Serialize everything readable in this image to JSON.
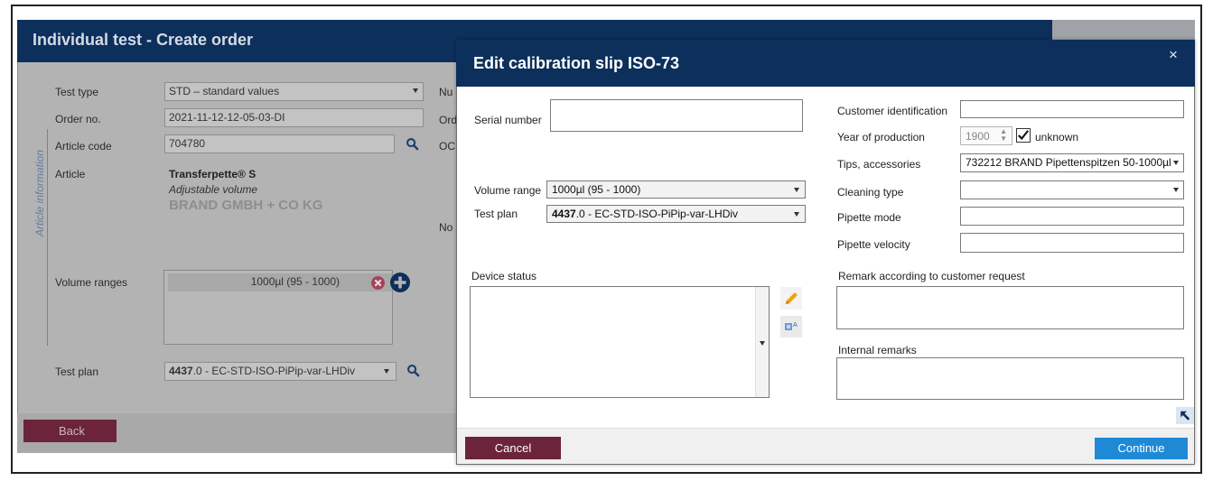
{
  "background_window": {
    "title": "Individual test - Create order",
    "side_label": "Article information",
    "fields": {
      "test_type_label": "Test type",
      "test_type_value": "STD – standard values",
      "order_no_label": "Order no.",
      "order_no_value": "2021-11-12-12-05-03-DI",
      "article_code_label": "Article code",
      "article_code_value": "704780",
      "article_label": "Article",
      "article_name": "Transferpette® S",
      "article_sub": "Adjustable volume",
      "article_maker": "BRAND GMBH + CO KG",
      "volume_ranges_label": "Volume ranges",
      "volume_range_chip": "1000µl (95 - 1000)",
      "test_plan_label": "Test plan",
      "test_plan_bold": "4437",
      "test_plan_rest": ".0 - EC-STD-ISO-PiPip-var-LHDiv"
    },
    "right_labels": [
      "Nu",
      "Ord",
      "OC",
      "No"
    ],
    "back_label": "Back"
  },
  "modal": {
    "title": "Edit calibration slip ISO-73",
    "close_glyph": "×",
    "serial_number_label": "Serial number",
    "serial_number_value": "",
    "volume_range_label": "Volume range",
    "volume_range_value": "1000µl (95 - 1000)",
    "test_plan_label": "Test plan",
    "test_plan_bold": "4437",
    "test_plan_rest": ".0 - EC-STD-ISO-PiPip-var-LHDiv",
    "device_status_label": "Device status",
    "device_status_value": "",
    "customer_identification_label": "Customer identification",
    "customer_identification_value": "",
    "year_of_production_label": "Year of production",
    "year_of_production_value": "1900",
    "unknown_label": "unknown",
    "unknown_checked": true,
    "tips_accessories_label": "Tips, accessories",
    "tips_accessories_value": "732212 BRAND Pipettenspitzen 50-1000µl",
    "cleaning_type_label": "Cleaning type",
    "cleaning_type_value": "",
    "pipette_mode_label": "Pipette mode",
    "pipette_velocity_label": "Pipette velocity",
    "remark_customer_label": "Remark according to customer request",
    "internal_remarks_label": "Internal remarks",
    "cancel_label": "Cancel",
    "continue_label": "Continue"
  },
  "colors": {
    "header_navy": "#0d2f5b",
    "cancel_maroon": "#6b2439",
    "continue_blue": "#1e8ad6",
    "edit_pencil": "#f0a30a"
  },
  "icons": [
    "magnifier-icon",
    "remove-circle-icon",
    "add-circle-icon",
    "pencil-icon",
    "translate-icon",
    "resize-arrow-icon",
    "checkmark-icon",
    "close-icon",
    "dropdown-caret-icon"
  ]
}
